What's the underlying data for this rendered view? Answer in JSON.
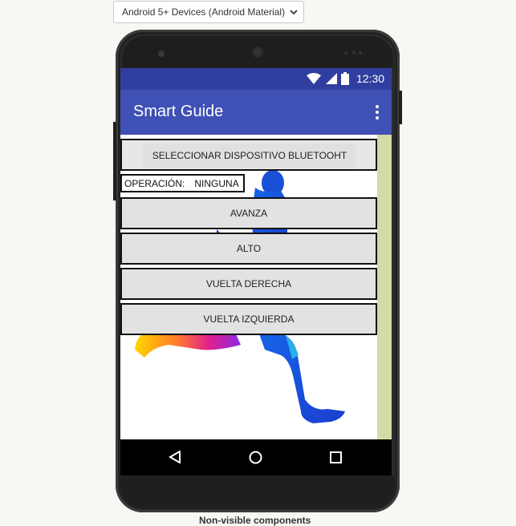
{
  "device_selector": {
    "selected": "Android 5+ Devices (Android Material)"
  },
  "status_bar": {
    "time": "12:30",
    "icons": [
      "wifi-icon",
      "signal-icon",
      "battery-icon"
    ]
  },
  "app_bar": {
    "title": "Smart Guide",
    "menu_icon": "more-vert-icon"
  },
  "screen": {
    "bluetooth_button": "SELECCIONAR DISPOSITIVO BLUETOOHT",
    "operation_label": "OPERACIÓN:",
    "operation_value": "NINGUNA",
    "buttons": [
      "AVANZA",
      "ALTO",
      "VUELTA DERECHA",
      "VUELTA IZQUIERDA"
    ],
    "background_image": "runner-illustration"
  },
  "nav_bar": {
    "icons": [
      "back-icon",
      "home-icon",
      "recents-icon"
    ]
  },
  "footer": {
    "non_visible_label": "Non-visible components"
  },
  "colors": {
    "status_bar": "#303f9f",
    "app_bar": "#3f51b5",
    "scroll_rail": "#d3dca6",
    "page_bg": "#f7f8f3"
  }
}
